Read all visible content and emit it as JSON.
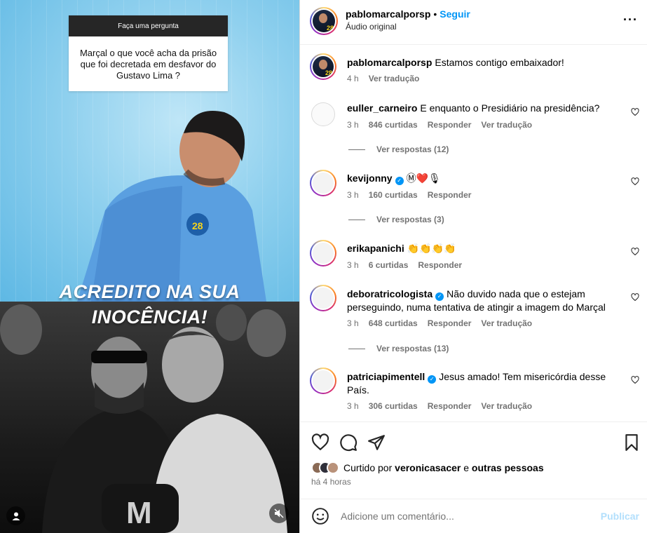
{
  "post": {
    "question_box": {
      "header": "Faça uma pergunta",
      "question": "Marçal o que você acha da prisão que foi decretada em desfavor do Gustavo Lima ?"
    },
    "headline_line1": "ACREDITO NA SUA",
    "headline_line2": "INOCÊNCIA!",
    "cap_letter": "M",
    "badge_number": "28"
  },
  "header": {
    "username": "pablomarcalporsp",
    "follow_label": "Seguir",
    "audio_label": "Áudio original",
    "more_label": "···"
  },
  "caption": {
    "username": "pablomarcalporsp",
    "text": "Estamos contigo embaixador!",
    "time": "4 h",
    "translate": "Ver tradução"
  },
  "comments": [
    {
      "username": "euller_carneiro",
      "verified": false,
      "text": "E enquanto o Presidiário na presidência?",
      "time": "3 h",
      "likes": "846 curtidas",
      "reply": "Responder",
      "translate": "Ver tradução",
      "view_replies": "Ver respostas (12)"
    },
    {
      "username": "kevijonny",
      "verified": true,
      "text": "Ⓜ❤️🎙",
      "time": "3 h",
      "likes": "160 curtidas",
      "reply": "Responder",
      "translate": "",
      "view_replies": "Ver respostas (3)"
    },
    {
      "username": "erikapanichi",
      "verified": false,
      "text": "👏👏👏👏",
      "time": "3 h",
      "likes": "6 curtidas",
      "reply": "Responder",
      "translate": "",
      "view_replies": ""
    },
    {
      "username": "deboratricologista",
      "verified": true,
      "text": "Não duvido nada que o estejam perseguindo, numa tentativa de atingir a imagem do Marçal",
      "time": "3 h",
      "likes": "648 curtidas",
      "reply": "Responder",
      "translate": "Ver tradução",
      "view_replies": "Ver respostas (13)"
    },
    {
      "username": "patriciapimentell",
      "verified": true,
      "text": "Jesus amado! Tem misericórdia desse País.",
      "time": "3 h",
      "likes": "306 curtidas",
      "reply": "Responder",
      "translate": "Ver tradução",
      "view_replies": ""
    }
  ],
  "likes_info": {
    "prefix": "Curtido por",
    "user": "veronicasacer",
    "conj": "e",
    "others": "outras pessoas",
    "time": "há 4 horas"
  },
  "add_comment": {
    "placeholder": "Adicione um comentário...",
    "publish": "Publicar"
  },
  "colors": {
    "accent": "#0095f6",
    "muted": "#737373",
    "publish_disabled": "#b2dffc"
  }
}
